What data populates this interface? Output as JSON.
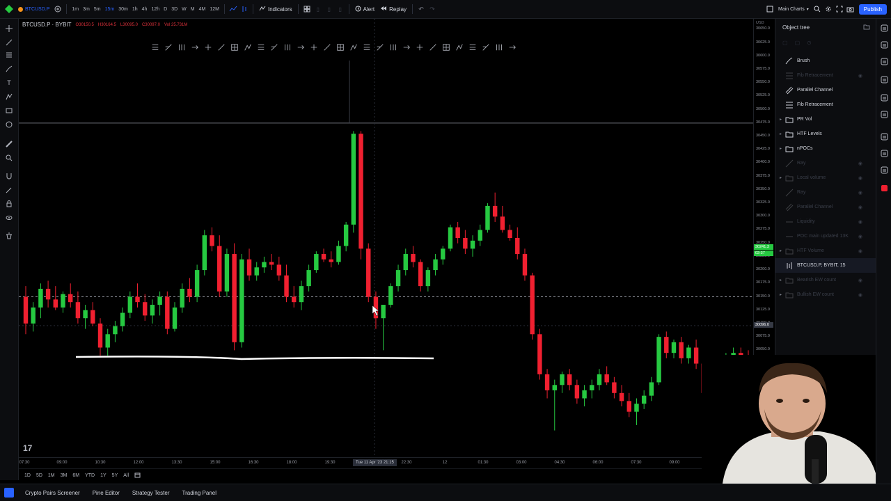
{
  "topbar": {
    "symbol": "BTCUSD.P",
    "timeframes": [
      "1m",
      "3m",
      "5m",
      "15m",
      "30m",
      "1h",
      "4h",
      "12h",
      "D",
      "3D",
      "W",
      "M",
      "4M",
      "12M"
    ],
    "active_timeframe": "15m",
    "indicators_label": "Indicators",
    "alert_label": "Alert",
    "replay_label": "Replay",
    "layout_label": "Main Charts",
    "publish_label": "Publish"
  },
  "legend": {
    "symbol": "BTCUSD.P · BYBIT",
    "open": "O30150.5",
    "high": "H30164.5",
    "low": "L30095.0",
    "close": "C30097.0",
    "volume": "Vol 25.731M"
  },
  "price_axis": {
    "currency": "USD",
    "ticks": [
      "30650.0",
      "30625.0",
      "30600.0",
      "30575.0",
      "30550.0",
      "30525.0",
      "30500.0",
      "30475.0",
      "30450.0",
      "30425.0",
      "30400.0",
      "30375.0",
      "30350.0",
      "30325.0",
      "30300.0",
      "30275.0",
      "30250.0",
      "30225.0",
      "30200.0",
      "30175.0",
      "30150.0",
      "30125.0",
      "30100.0",
      "30075.0",
      "30050.0",
      "30025.0",
      "30000.0",
      "29975.0",
      "29950.0",
      "29925.0",
      "29900.0",
      "29875.0"
    ],
    "current_price": "30241.3",
    "current_time": "02:37",
    "crosshair_price": "30096.0",
    "red_price": "30014.0"
  },
  "time_axis": {
    "ticks": [
      "07:30",
      "09:00",
      "10:30",
      "12:00",
      "13:30",
      "15:00",
      "16:30",
      "18:00",
      "19:30",
      "21:00",
      "22:30",
      "12",
      "01:30",
      "03:00",
      "04:30",
      "06:00",
      "07:30",
      "09:00",
      "10:30"
    ],
    "crosshair_label": "Tue 11 Apr '23  21:15",
    "clock": "09:4"
  },
  "range_bar": [
    "1D",
    "5D",
    "1M",
    "3M",
    "6M",
    "YTD",
    "1Y",
    "5Y",
    "All"
  ],
  "bottom_tabs": [
    "Crypto Pairs Screener",
    "Pine Editor",
    "Strategy Tester",
    "Trading Panel"
  ],
  "object_tree": {
    "title": "Object tree",
    "items": [
      {
        "label": "Brush",
        "icon": "brush-icon",
        "dim": false
      },
      {
        "label": "Fib Retracement",
        "icon": "fib-icon",
        "dim": true
      },
      {
        "label": "Parallel Channel",
        "icon": "channel-icon",
        "dim": false
      },
      {
        "label": "Fib Retracement",
        "icon": "fib-icon",
        "dim": false
      },
      {
        "label": "PR Vol",
        "icon": "folder-icon",
        "dim": false
      },
      {
        "label": "HTF Levels",
        "icon": "folder-icon",
        "dim": false
      },
      {
        "label": "nPOCs",
        "icon": "folder-icon",
        "dim": false
      },
      {
        "label": "Ray",
        "icon": "ray-icon",
        "dim": true
      },
      {
        "label": "Local volume",
        "icon": "folder-icon",
        "dim": true
      },
      {
        "label": "Ray",
        "icon": "ray-icon",
        "dim": true
      },
      {
        "label": "Parallel Channel",
        "icon": "channel-icon",
        "dim": true
      },
      {
        "label": "Liquidity",
        "icon": "line-icon",
        "dim": true
      },
      {
        "label": "POC main updated 13K",
        "icon": "line-icon",
        "dim": true
      },
      {
        "label": "HTF Volume",
        "icon": "folder-icon",
        "dim": true
      },
      {
        "label": "BTCUSD.P, BYBIT, 15",
        "icon": "series-icon",
        "dim": false
      },
      {
        "label": "Bearish EW count",
        "icon": "folder-icon",
        "dim": true
      },
      {
        "label": "Bullish EW count",
        "icon": "folder-icon",
        "dim": true
      }
    ]
  },
  "colors": {
    "bull": "#26c941",
    "bear": "#f02030",
    "accent": "#2962ff",
    "bg": "#000000"
  },
  "chart_data": {
    "type": "candlestick",
    "symbol": "BTCUSD.P",
    "x_start": "07:30",
    "x_end": "10:30",
    "ylim": [
      29850,
      30670
    ],
    "candles": [
      [
        30150,
        30170,
        30080,
        30100
      ],
      [
        30100,
        30140,
        30085,
        30130
      ],
      [
        30130,
        30175,
        30110,
        30165
      ],
      [
        30165,
        30180,
        30130,
        30145
      ],
      [
        30145,
        30170,
        30125,
        30130
      ],
      [
        30130,
        30160,
        30120,
        30155
      ],
      [
        30155,
        30175,
        30130,
        30140
      ],
      [
        30140,
        30160,
        30100,
        30110
      ],
      [
        30110,
        30135,
        30090,
        30125
      ],
      [
        30125,
        30140,
        30095,
        30100
      ],
      [
        30100,
        30110,
        30040,
        30055
      ],
      [
        30055,
        30090,
        30040,
        30080
      ],
      [
        30080,
        30105,
        30065,
        30095
      ],
      [
        30095,
        30130,
        30085,
        30120
      ],
      [
        30120,
        30160,
        30110,
        30150
      ],
      [
        30150,
        30175,
        30130,
        30140
      ],
      [
        30140,
        30155,
        30105,
        30115
      ],
      [
        30115,
        30145,
        30100,
        30135
      ],
      [
        30135,
        30160,
        30115,
        30150
      ],
      [
        30150,
        30160,
        30080,
        30090
      ],
      [
        30090,
        30140,
        30085,
        30130
      ],
      [
        30130,
        30175,
        30120,
        30165
      ],
      [
        30165,
        30185,
        30140,
        30150
      ],
      [
        30150,
        30210,
        30140,
        30200
      ],
      [
        30200,
        30275,
        30190,
        30265
      ],
      [
        30265,
        30280,
        30235,
        30245
      ],
      [
        30245,
        30265,
        30150,
        30160
      ],
      [
        30160,
        30240,
        30150,
        30230
      ],
      [
        30230,
        30250,
        30050,
        30065
      ],
      [
        30065,
        30230,
        30055,
        30220
      ],
      [
        30220,
        30240,
        30180,
        30190
      ],
      [
        30190,
        30215,
        30180,
        30205
      ],
      [
        30205,
        30225,
        30195,
        30215
      ],
      [
        30215,
        30230,
        30200,
        30210
      ],
      [
        30210,
        30225,
        30180,
        30190
      ],
      [
        30190,
        30210,
        30140,
        30150
      ],
      [
        30150,
        30170,
        30130,
        30140
      ],
      [
        30140,
        30180,
        30125,
        30170
      ],
      [
        30170,
        30210,
        30160,
        30200
      ],
      [
        30200,
        30235,
        30195,
        30230
      ],
      [
        30230,
        30240,
        30215,
        30220
      ],
      [
        30220,
        30235,
        30205,
        30215
      ],
      [
        30215,
        30255,
        30210,
        30245
      ],
      [
        30245,
        30290,
        30235,
        30285
      ],
      [
        30285,
        30460,
        30270,
        30455
      ],
      [
        30455,
        30460,
        30220,
        30240
      ],
      [
        30240,
        30250,
        30140,
        30150
      ],
      [
        30150,
        30160,
        30090,
        30110
      ],
      [
        30110,
        30130,
        30050,
        30135
      ],
      [
        30135,
        30175,
        30130,
        30170
      ],
      [
        30170,
        30210,
        30160,
        30200
      ],
      [
        30200,
        30240,
        30190,
        30230
      ],
      [
        30230,
        30245,
        30205,
        30215
      ],
      [
        30215,
        30220,
        30160,
        30170
      ],
      [
        30170,
        30205,
        30160,
        30200
      ],
      [
        30200,
        30230,
        30190,
        30220
      ],
      [
        30220,
        30245,
        30210,
        30240
      ],
      [
        30240,
        30285,
        30235,
        30280
      ],
      [
        30280,
        30290,
        30250,
        30260
      ],
      [
        30260,
        30275,
        30230,
        30240
      ],
      [
        30240,
        30265,
        30225,
        30255
      ],
      [
        30255,
        30285,
        30245,
        30275
      ],
      [
        30275,
        30325,
        30270,
        30320
      ],
      [
        30320,
        30345,
        30290,
        30300
      ],
      [
        30300,
        30320,
        30270,
        30275
      ],
      [
        30275,
        30285,
        30255,
        30260
      ],
      [
        30260,
        30280,
        30220,
        30230
      ],
      [
        30230,
        30240,
        30180,
        30190
      ],
      [
        30190,
        30195,
        30070,
        30080
      ],
      [
        30080,
        30090,
        29995,
        30005
      ],
      [
        30005,
        30015,
        29960,
        29975
      ],
      [
        29975,
        29995,
        29900,
        29985
      ],
      [
        29985,
        30010,
        29970,
        30005
      ],
      [
        30005,
        30015,
        29975,
        29985
      ],
      [
        29985,
        29995,
        29950,
        29960
      ],
      [
        29960,
        29985,
        29945,
        29975
      ],
      [
        29975,
        29995,
        29960,
        29985
      ],
      [
        29985,
        30015,
        29975,
        30005
      ],
      [
        30005,
        30020,
        29985,
        29990
      ],
      [
        29990,
        30000,
        29960,
        29970
      ],
      [
        29970,
        29985,
        29945,
        29955
      ],
      [
        29955,
        29970,
        29925,
        29935
      ],
      [
        29935,
        29960,
        29910,
        29950
      ],
      [
        29950,
        29975,
        29940,
        29965
      ],
      [
        29965,
        30000,
        29955,
        29990
      ],
      [
        29990,
        30080,
        29985,
        30075
      ],
      [
        30075,
        30085,
        30035,
        30045
      ],
      [
        30045,
        30070,
        30035,
        30065
      ],
      [
        30065,
        30075,
        30025,
        30035
      ],
      [
        30035,
        30060,
        30025,
        30055
      ],
      [
        30055,
        30070,
        30015,
        30025
      ],
      [
        30025,
        30030,
        29960,
        29970
      ],
      [
        29970,
        29995,
        29960,
        29985
      ],
      [
        29985,
        30030,
        29975,
        30020
      ],
      [
        30020,
        30045,
        30010,
        30040
      ],
      [
        30040,
        30055,
        30030,
        30045
      ],
      [
        30045,
        30055,
        30025,
        30035
      ],
      [
        30035,
        30050,
        30010,
        30020
      ]
    ]
  }
}
